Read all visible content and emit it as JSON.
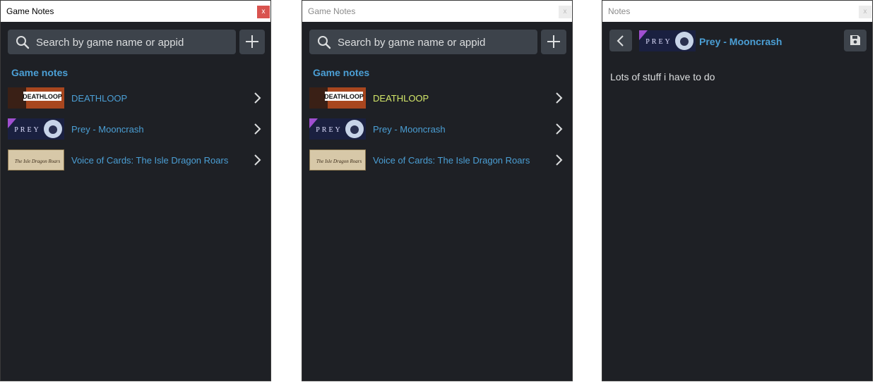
{
  "window1": {
    "title": "Game Notes",
    "close_label": "x",
    "search_placeholder": "Search by game name or appid",
    "section_title": "Game notes",
    "games": [
      {
        "name": "DEATHLOOP",
        "thumb_text": "DEATHLOOP"
      },
      {
        "name": "Prey - Mooncrash",
        "thumb_text": "PREY"
      },
      {
        "name": "Voice of Cards: The Isle Dragon Roars",
        "thumb_text": "The Isle Dragon Roars"
      }
    ]
  },
  "window2": {
    "title": "Game Notes",
    "close_label": "x",
    "search_placeholder": "Search by game name or appid",
    "section_title": "Game notes",
    "games": [
      {
        "name": "DEATHLOOP",
        "thumb_text": "DEATHLOOP"
      },
      {
        "name": "Prey - Mooncrash",
        "thumb_text": "PREY"
      },
      {
        "name": "Voice of Cards: The Isle Dragon Roars",
        "thumb_text": "The Isle Dragon Roars"
      }
    ]
  },
  "window3": {
    "title": "Notes",
    "close_label": "x",
    "game_title": "Prey - Mooncrash",
    "thumb_text": "PREY",
    "note_text": "Lots of stuff i have to do"
  },
  "colors": {
    "background": "#1e2025",
    "accent": "#4b9fd5",
    "hover_text": "#d4e86a",
    "button": "#3d434b",
    "close_active": "#d9534f"
  }
}
